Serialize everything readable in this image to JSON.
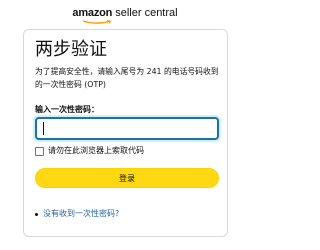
{
  "header": {
    "logo_brand": "amazon",
    "logo_product": " seller central",
    "logo_icon": "amazon-smile-logo"
  },
  "form": {
    "title": "两步验证",
    "description": "为了提高安全性，请输入尾号为 241 的电话号码收到的一次性密码 (OTP)",
    "otp_label": "输入一次性密码：",
    "otp_value": "",
    "remember_label": "请勿在此浏览器上索取代码",
    "remember_checked": false,
    "submit_label": "登录",
    "help_link": "没有收到一次性密码?"
  },
  "colors": {
    "button_bg": "#ffd814",
    "input_border": "#1f6fa8",
    "link": "#2162a1"
  }
}
